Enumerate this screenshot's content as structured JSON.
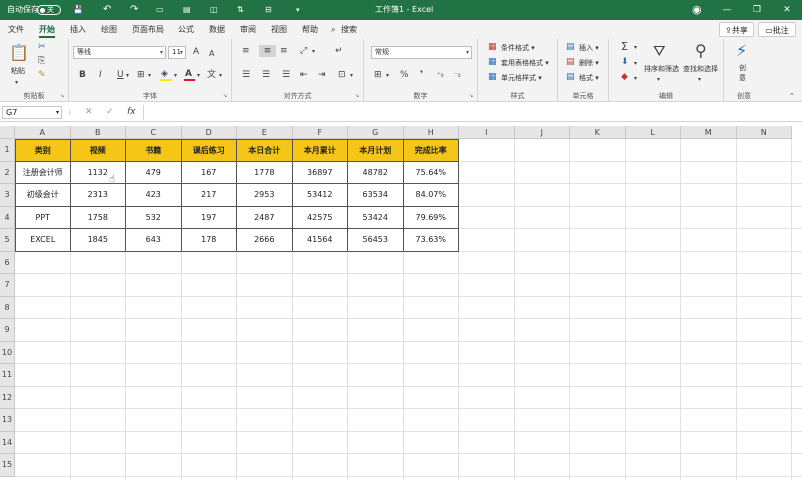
{
  "titlebar": {
    "autosave_label": "自动保存",
    "autosave_state": "关",
    "doc_title": "工作簿1 - Excel",
    "icons": [
      "save-icon",
      "undo-icon",
      "redo-icon",
      "customize-icon",
      "more-icon"
    ],
    "bg_color": "#217346"
  },
  "menu": {
    "tabs": [
      "文件",
      "开始",
      "插入",
      "绘图",
      "页面布局",
      "公式",
      "数据",
      "审阅",
      "视图",
      "帮助"
    ],
    "search": "搜索",
    "share": "共享",
    "comments": "批注",
    "active_tab": "开始"
  },
  "ribbon": {
    "clipboard": {
      "paste": "粘贴",
      "label": "剪贴板"
    },
    "font": {
      "name": "等线",
      "size": "11",
      "bold": "B",
      "italic": "I",
      "underline": "U",
      "grow": "A",
      "shrink": "A",
      "color_a": "A",
      "label": "字体"
    },
    "align": {
      "label": "对齐方式"
    },
    "number": {
      "format": "常规",
      "percent": "%",
      "comma": "❜",
      "label": "数字"
    },
    "styles": {
      "cond": "条件格式",
      "table": "套用表格格式",
      "cell": "单元格样式",
      "label": "样式"
    },
    "cells": {
      "insert": "插入",
      "delete": "删除",
      "format": "格式",
      "label": "单元格"
    },
    "editing": {
      "sum": "Σ",
      "sort": "排序和筛选",
      "find": "查找和选择",
      "label": "编辑"
    },
    "ideas": {
      "name": "创意",
      "sub": "创\n意",
      "label": "创意"
    }
  },
  "formula_bar": {
    "name_box": "G7",
    "cancel": "✕",
    "enter": "✓",
    "fx": "fx",
    "value": ""
  },
  "sheet": {
    "columns": [
      "A",
      "B",
      "C",
      "D",
      "E",
      "F",
      "G",
      "H",
      "I",
      "J",
      "K",
      "L",
      "M",
      "N"
    ],
    "rows": [
      "1",
      "2",
      "3",
      "4",
      "5",
      "6",
      "7",
      "8",
      "9",
      "10",
      "11",
      "12",
      "13",
      "14",
      "15"
    ],
    "header": [
      "类别",
      "视频",
      "书籍",
      "课后练习",
      "本日合计",
      "本月累计",
      "本月计划",
      "完成比率"
    ],
    "data": [
      [
        "注册会计师",
        "1132",
        "479",
        "167",
        "1778",
        "36897",
        "48782",
        "75.64%"
      ],
      [
        "初级会计",
        "2313",
        "423",
        "217",
        "2953",
        "53412",
        "63534",
        "84.07%"
      ],
      [
        "PPT",
        "1758",
        "532",
        "197",
        "2487",
        "42575",
        "53424",
        "79.69%"
      ],
      [
        "EXCEL",
        "1845",
        "643",
        "178",
        "2666",
        "41564",
        "56453",
        "73.63%"
      ]
    ],
    "header_color": "#f5c518"
  }
}
